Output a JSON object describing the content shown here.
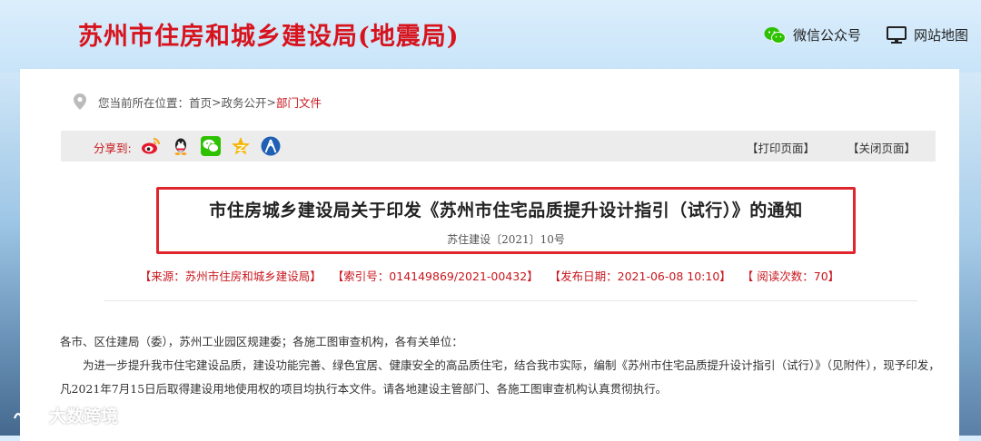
{
  "header": {
    "site_title": "苏州市住房和城乡建设局(地震局)",
    "links": [
      {
        "icon": "wechat-icon",
        "label": "微信公众号"
      },
      {
        "icon": "monitor-icon",
        "label": "网站地图"
      }
    ]
  },
  "breadcrumb": {
    "prefix": "您当前所在位置：",
    "home": "首页",
    "sep1": ">",
    "section": "政务公开",
    "sep2": ">",
    "current": "部门文件"
  },
  "sharebar": {
    "label": "分享到:",
    "icons": [
      "weibo-icon",
      "qq-icon",
      "wechat-share-icon",
      "qzone-icon",
      "renren-icon"
    ],
    "print_label": "【打印页面】",
    "close_label": "【关闭页面】"
  },
  "article": {
    "title": "市住房城乡建设局关于印发《苏州市住宅品质提升设计指引（试行）》的通知",
    "doc_number": "苏住建设〔2021〕10号",
    "meta": {
      "source": "【来源：苏州市住房和城乡建设局】",
      "index": "【索引号：014149869/2021-00432】",
      "date": "【发布日期：2021-06-08 10:10】",
      "views": "【 阅读次数：70】"
    },
    "salutation": "各市、区住建局（委），苏州工业园区规建委；各施工图审查机构，各有关单位：",
    "paragraph": "为进一步提升我市住宅建设品质，建设功能完善、绿色宜居、健康安全的高品质住宅，结合我市实际，编制《苏州市住宅品质提升设计指引（试行）》（见附件），现予印发，凡2021年7月15日后取得建设用地使用权的项目均执行本文件。请各地建设主管部门、各施工图审查机构认真贯彻执行。"
  },
  "watermark": {
    "text": "大数跨境"
  },
  "colors": {
    "brand_red": "#d7141e",
    "link_red": "#c8161d",
    "highlight_border": "#e0262d"
  }
}
